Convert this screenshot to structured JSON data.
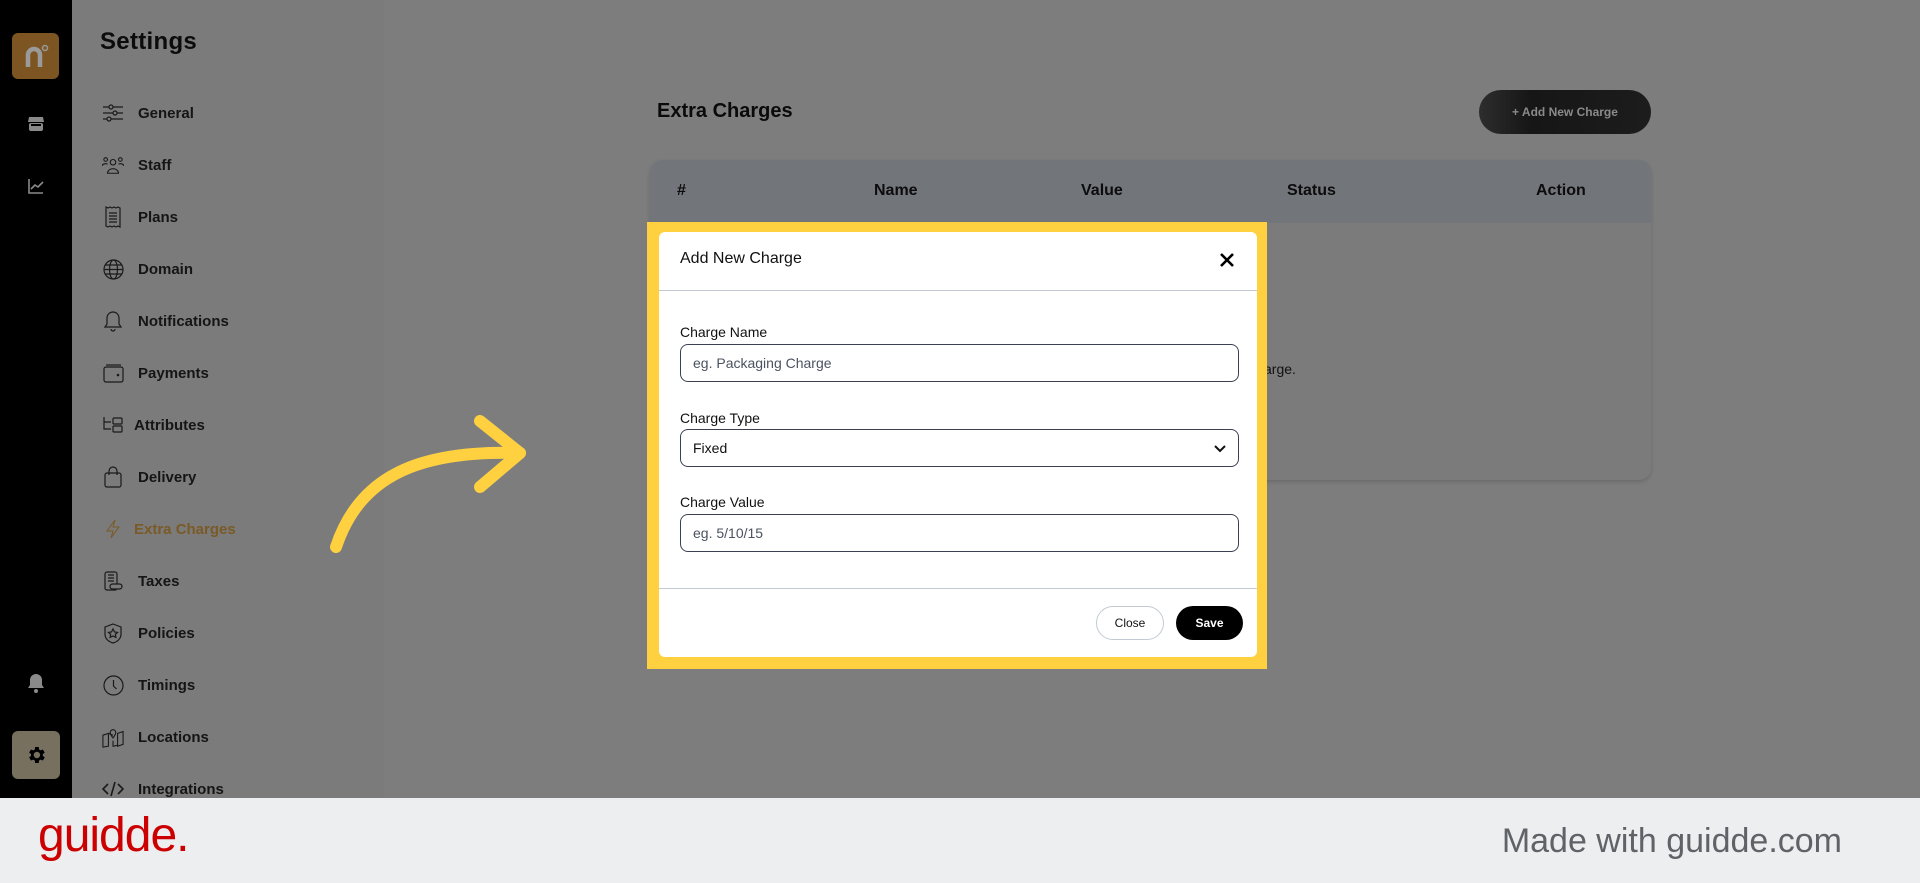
{
  "app": {
    "logo_letter": "n",
    "rail": {
      "icons": [
        "store-icon",
        "analytics-icon",
        "bell-icon",
        "gear-icon"
      ]
    }
  },
  "settings": {
    "title": "Settings",
    "items": [
      {
        "label": "General",
        "icon": "sliders-icon"
      },
      {
        "label": "Staff",
        "icon": "users-icon"
      },
      {
        "label": "Plans",
        "icon": "receipt-icon"
      },
      {
        "label": "Domain",
        "icon": "globe-icon"
      },
      {
        "label": "Notifications",
        "icon": "bell-icon"
      },
      {
        "label": "Payments",
        "icon": "wallet-icon"
      },
      {
        "label": "Attributes",
        "icon": "hierarchy-icon"
      },
      {
        "label": "Delivery",
        "icon": "bag-icon"
      },
      {
        "label": "Extra Charges",
        "icon": "lightning-icon",
        "active": true
      },
      {
        "label": "Taxes",
        "icon": "tax-icon"
      },
      {
        "label": "Policies",
        "icon": "shield-star-icon"
      },
      {
        "label": "Timings",
        "icon": "clock-icon"
      },
      {
        "label": "Locations",
        "icon": "map-pin-icon"
      },
      {
        "label": "Integrations",
        "icon": "code-icon"
      }
    ]
  },
  "main": {
    "title": "Extra Charges",
    "add_button": "+ Add New Charge",
    "table": {
      "columns": [
        "#",
        "Name",
        "Value",
        "Status",
        "Action"
      ]
    },
    "empty_fragment": "arge."
  },
  "modal": {
    "title": "Add New Charge",
    "fields": {
      "name": {
        "label": "Charge Name",
        "placeholder": "eg. Packaging Charge",
        "value": ""
      },
      "type": {
        "label": "Charge Type",
        "value": "Fixed"
      },
      "value": {
        "label": "Charge Value",
        "placeholder": "eg. 5/10/15",
        "value": ""
      }
    },
    "close_label": "Close",
    "save_label": "Save"
  },
  "colors": {
    "highlight": "#ffd140",
    "active_nav": "#7a5a26",
    "guidde_red": "#cc0000"
  },
  "guidde": {
    "logo": "guidde.",
    "made_with": "Made with guidde.com"
  }
}
